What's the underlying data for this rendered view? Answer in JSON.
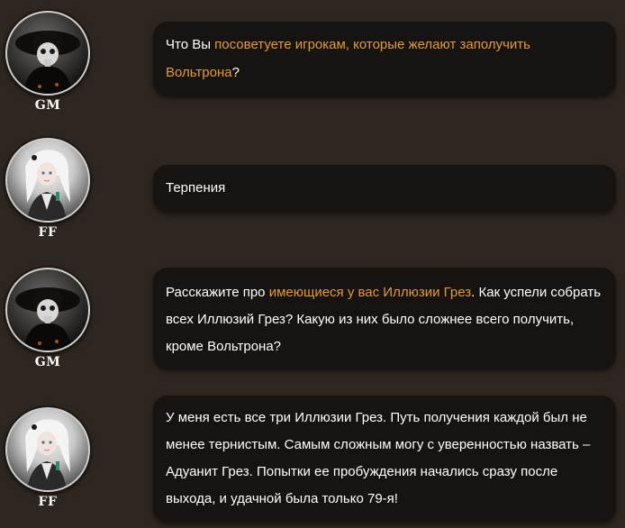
{
  "colors": {
    "background": "#2e2620",
    "bubble": "#171310",
    "text": "#ffffff",
    "highlight": "#e39a3b"
  },
  "messages": [
    {
      "speaker": "GM",
      "avatar_icon": "plague-doctor-avatar-icon",
      "parts": [
        {
          "text": "Что Вы "
        },
        {
          "text": "посоветуете игрокам, которые желают заполучить Вольтрона",
          "highlight": true
        },
        {
          "text": "?"
        }
      ]
    },
    {
      "speaker": "FF",
      "avatar_icon": "white-haired-character-avatar-icon",
      "parts": [
        {
          "text": "Терпения"
        }
      ]
    },
    {
      "speaker": "GM",
      "avatar_icon": "plague-doctor-avatar-icon",
      "parts": [
        {
          "text": "Расскажите про "
        },
        {
          "text": "имеющиеся у вас Иллюзии Грез",
          "highlight": true
        },
        {
          "text": ". Как успели собрать всех Иллюзий Грез? Какую из них было сложнее всего получить, кроме Вольтрона?"
        }
      ]
    },
    {
      "speaker": "FF",
      "avatar_icon": "white-haired-character-avatar-icon",
      "parts": [
        {
          "text": "У меня есть все три Иллюзии Грез. Путь получения каждой был не менее тернистым. Самым сложным могу с уверенностью назвать – Адуанит Грез. Попытки ее пробуждения начались сразу после выхода, и удачной была только 79-я!"
        }
      ]
    }
  ]
}
